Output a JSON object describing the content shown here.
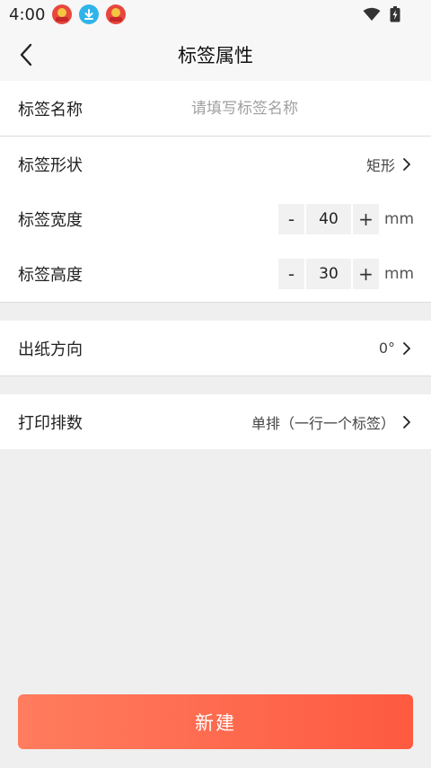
{
  "status_bar": {
    "time": "4:00"
  },
  "header": {
    "title": "标签属性"
  },
  "label_name": {
    "label": "标签名称",
    "placeholder": "请填写标签名称",
    "value": ""
  },
  "label_shape": {
    "label": "标签形状",
    "value": "矩形"
  },
  "label_width": {
    "label": "标签宽度",
    "minus": "-",
    "value": "40",
    "plus": "+",
    "unit": "mm"
  },
  "label_height": {
    "label": "标签高度",
    "minus": "-",
    "value": "30",
    "plus": "+",
    "unit": "mm"
  },
  "paper_direction": {
    "label": "出纸方向",
    "value": "0°"
  },
  "print_rows": {
    "label": "打印排数",
    "value": "单排（一行一个标签）"
  },
  "create_button": {
    "label": "新建"
  },
  "colors": {
    "accent_start": "#ff7c5e",
    "accent_end": "#fe5a40",
    "background": "#efefef"
  },
  "icons": [
    "back-icon",
    "chevron-right-icon",
    "wifi-icon",
    "battery-icon",
    "download-icon"
  ]
}
